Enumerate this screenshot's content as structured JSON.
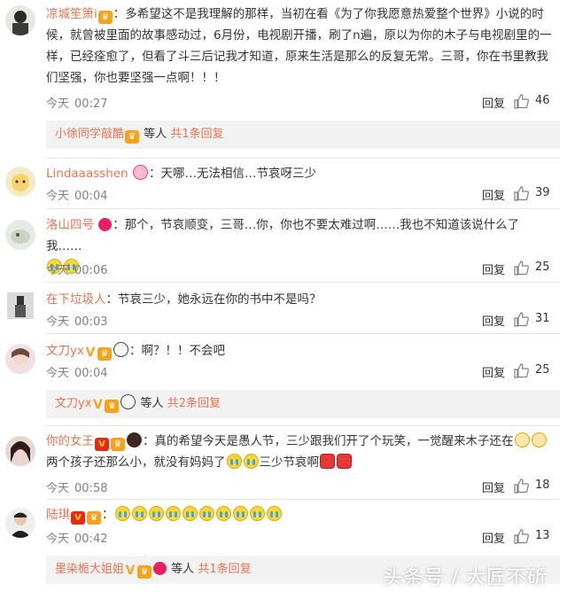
{
  "comments": [
    {
      "user": "凉城笙箫i",
      "text": "：多希望这不是我理解的那样，当初在看《为了你我愿意热爱整个世界》小说的时候，就曾被里面的故事感动过，6月份，电视剧开播，刷了n遍，原以为你的木子与电视剧里的一样，已经痊愈了，但看了斗三后记我才知道，原来生活是那么的反复无常。三哥，你在书里教我们坚强，你也要坚强一点啊！！！",
      "time_label": "今天",
      "time": "00:27",
      "reply": "回复",
      "likes": "46",
      "sub_user": "小徐同学敲酷",
      "sub_suffix": "等人",
      "sub_count": "共1条回复"
    },
    {
      "user": "Lindaaasshen",
      "text": "：天哪…无法相信…节哀呀三少",
      "time_label": "今天",
      "time": "00:04",
      "reply": "回复",
      "likes": "39"
    },
    {
      "user": "洛山四号",
      "text": "：那个，节哀顺变，三哥…你，你也不要太难过啊……我也不知道该说什么了我……",
      "time_label": "今天",
      "time": "00:06",
      "reply": "回复",
      "likes": "25"
    },
    {
      "user": "在下垃圾人",
      "text": "：节哀三少，她永远在你的书中不是吗？",
      "time_label": "今天",
      "time": "00:03",
      "reply": "回复",
      "likes": "31"
    },
    {
      "user": "文刀yx",
      "text": "：啊？！！不会吧",
      "time_label": "今天",
      "time": "00:04",
      "reply": "回复",
      "likes": "25",
      "sub_user": "文刀yx",
      "sub_suffix": "等人",
      "sub_count": "共2条回复"
    },
    {
      "user": "你的女王",
      "text": "：真的希望今天是愚人节，三少跟我们开了个玩笑，一觉醒来木子还在",
      "text2": "两个孩子还那么小，就没有妈妈了",
      "text3": "三少节哀啊",
      "time_label": "今天",
      "time": "00:58",
      "reply": "回复",
      "likes": "18"
    },
    {
      "user": "陆琪",
      "text": "：",
      "time_label": "今天",
      "time": "00:42",
      "reply": "回复",
      "likes": "13",
      "sub_user": "墨染栀大姐姐",
      "sub_suffix": "等人",
      "sub_count": "共1条回复"
    }
  ],
  "watermark": "头条号 / 大匠不斫",
  "colors": {
    "username": "#eb7350",
    "meta": "#808080",
    "sub_bg": "#f2f2f2"
  }
}
